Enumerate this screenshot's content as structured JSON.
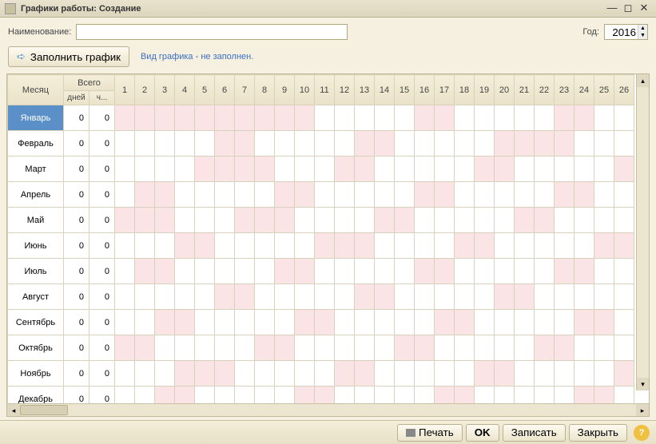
{
  "title": "Графики работы: Создание",
  "labels": {
    "name": "Наименование:",
    "year": "Год:",
    "fill": "Заполнить график",
    "info": "Вид графика - не заполнен.",
    "month": "Месяц",
    "total": "Всего",
    "days": "дней",
    "hours": "ч...",
    "print": "Печать",
    "ok": "OK",
    "save": "Записать",
    "close": "Закрыть"
  },
  "year": "2016",
  "dayCols": [
    1,
    2,
    3,
    4,
    5,
    6,
    7,
    8,
    9,
    10,
    11,
    12,
    13,
    14,
    15,
    16,
    17,
    18,
    19,
    20,
    21,
    22,
    23,
    24,
    25,
    26
  ],
  "months": [
    {
      "name": "Январь",
      "days": 0,
      "hours": 0,
      "wk": [
        1,
        2,
        3,
        4,
        5,
        6,
        7,
        8,
        9,
        10,
        16,
        17,
        23,
        24
      ]
    },
    {
      "name": "Февраль",
      "days": 0,
      "hours": 0,
      "wk": [
        6,
        7,
        13,
        14,
        20,
        21,
        22,
        23
      ]
    },
    {
      "name": "Март",
      "days": 0,
      "hours": 0,
      "wk": [
        5,
        6,
        7,
        8,
        12,
        13,
        19,
        20,
        26
      ]
    },
    {
      "name": "Апрель",
      "days": 0,
      "hours": 0,
      "wk": [
        2,
        3,
        9,
        10,
        16,
        17,
        23,
        24
      ]
    },
    {
      "name": "Май",
      "days": 0,
      "hours": 0,
      "wk": [
        1,
        2,
        3,
        7,
        8,
        9,
        14,
        15,
        21,
        22
      ]
    },
    {
      "name": "Июнь",
      "days": 0,
      "hours": 0,
      "wk": [
        4,
        5,
        11,
        12,
        13,
        18,
        19,
        25,
        26
      ]
    },
    {
      "name": "Июль",
      "days": 0,
      "hours": 0,
      "wk": [
        2,
        3,
        9,
        10,
        16,
        17,
        23,
        24
      ]
    },
    {
      "name": "Август",
      "days": 0,
      "hours": 0,
      "wk": [
        6,
        7,
        13,
        14,
        20,
        21
      ]
    },
    {
      "name": "Сентябрь",
      "days": 0,
      "hours": 0,
      "wk": [
        3,
        4,
        10,
        11,
        17,
        18,
        24,
        25
      ]
    },
    {
      "name": "Октябрь",
      "days": 0,
      "hours": 0,
      "wk": [
        1,
        2,
        8,
        9,
        15,
        16,
        22,
        23
      ]
    },
    {
      "name": "Ноябрь",
      "days": 0,
      "hours": 0,
      "wk": [
        4,
        5,
        6,
        12,
        13,
        19,
        20,
        26
      ]
    },
    {
      "name": "Декабрь",
      "days": 0,
      "hours": 0,
      "wk": [
        3,
        4,
        10,
        11,
        17,
        18,
        24,
        25
      ]
    }
  ]
}
